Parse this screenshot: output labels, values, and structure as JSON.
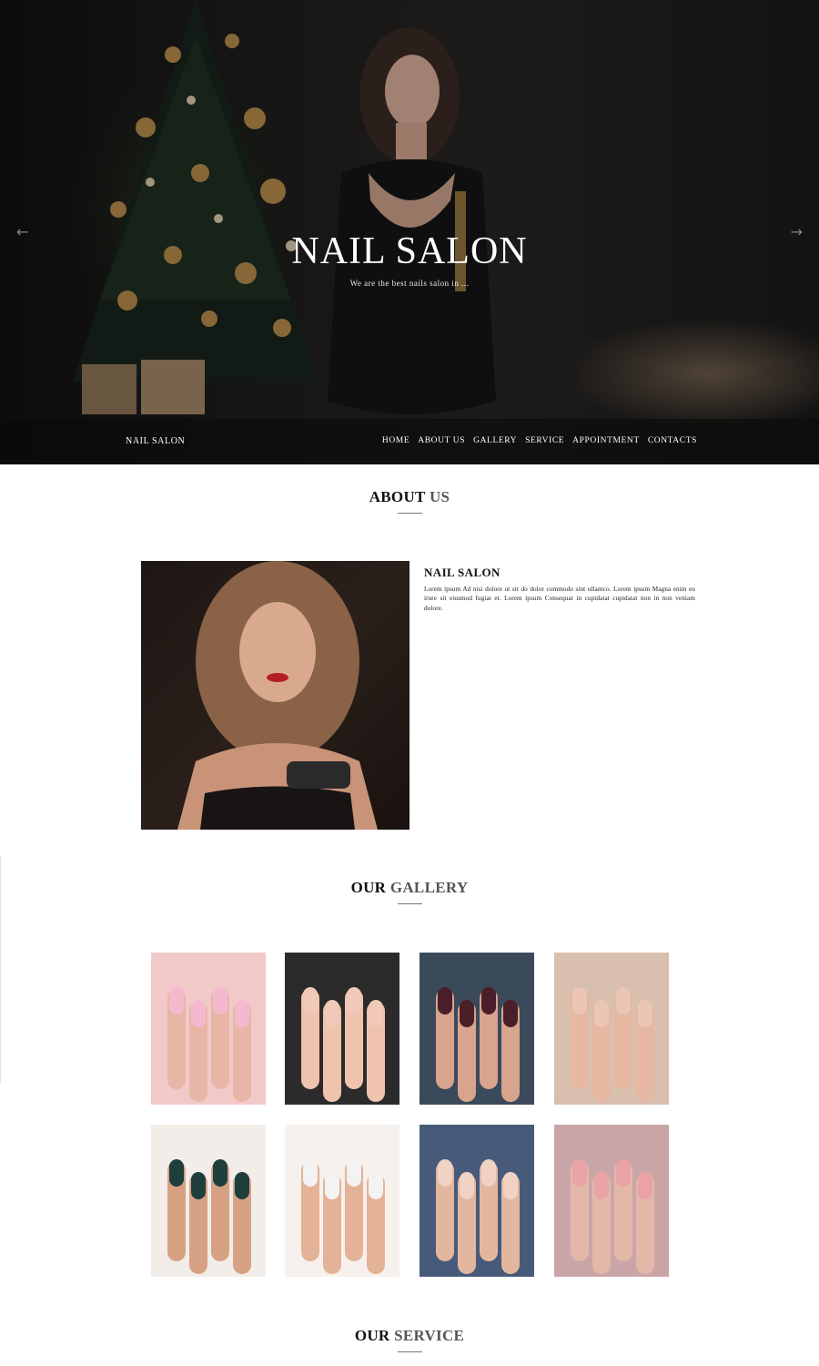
{
  "hero": {
    "title": "NAIL SALON",
    "subtitle": "We are the best nails salon in ...",
    "prev_icon": "arrow-left-icon",
    "next_icon": "arrow-right-icon"
  },
  "navbar": {
    "brand": "NAIL SALON",
    "items": [
      {
        "label": "HOME"
      },
      {
        "label": "ABOUT US"
      },
      {
        "label": "GALLERY"
      },
      {
        "label": "SERVICE"
      },
      {
        "label": "APPOINTMENT"
      },
      {
        "label": "CONTACTS"
      }
    ]
  },
  "about": {
    "heading_bold": "ABOUT",
    "heading_light": "US",
    "title": "NAIL SALON",
    "text": "Lorem ipsum Ad nisi dolore ut sit do dolor commodo sint ullamco. Lorem ipsum Magna enim eu irure sit eiusmod fugiat et. Lorem ipsum Consequat in cupidatat cupidatat non in non veniam dolore."
  },
  "gallery": {
    "heading_bold": "OUR",
    "heading_light": "GALLERY",
    "items": [
      {
        "name": "pink matte nails",
        "base": "#f1c9c8",
        "nail": "#f4b9cf",
        "skin": "#e7b6a6"
      },
      {
        "name": "nude nails with rings",
        "base": "#2b2b2b",
        "nail": "#f0c9b8",
        "skin": "#efc3ae"
      },
      {
        "name": "burgundy and white nails",
        "base": "#3a4a5a",
        "nail": "#4a1f2a",
        "skin": "#d8a48e"
      },
      {
        "name": "beige nails with line art",
        "base": "#d8bfae",
        "nail": "#ecc6b5",
        "skin": "#e6b7a1"
      },
      {
        "name": "green chrome nails",
        "base": "#f2ede8",
        "nail": "#1f3f3c",
        "skin": "#d7a184"
      },
      {
        "name": "white and black glitter nails",
        "base": "#f6f1ec",
        "nail": "#f3f3f3",
        "skin": "#e4b297"
      },
      {
        "name": "marble nails on denim",
        "base": "#475a7a",
        "nail": "#f0d2c5",
        "skin": "#e3b79f"
      },
      {
        "name": "pink nails with silver rings",
        "base": "#caa5a8",
        "nail": "#e9a3a6",
        "skin": "#e4b8a8"
      }
    ]
  },
  "service": {
    "heading_bold": "OUR",
    "heading_light": "SERVICE"
  }
}
